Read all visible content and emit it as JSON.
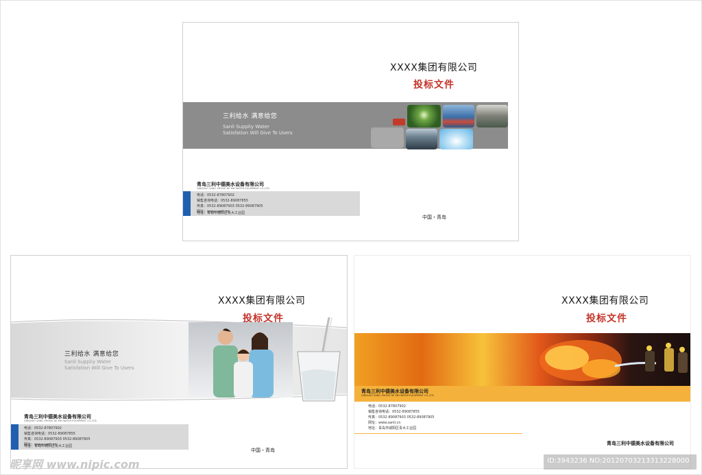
{
  "company_name": "XXXX集团有限公司",
  "doc_title": "投标文件",
  "slogan_cn": "三利给水 满意给您",
  "slogan_en_line1": "Sanli Suppliy Water",
  "slogan_en_line2": "Satisfation Will Give To Users",
  "supplier_cn": "青岛三利中德美水设备有限公司",
  "supplier_en": "QINGDAO SANLI ZHONG DE MEI WATER EQUIPMENT CO.,LTD.",
  "contact": {
    "phone": "电话：0532-87807902",
    "sales": "销售咨询电话：0532-89087855",
    "fax": "传真：0532-89087903 0532-89087905",
    "website": "网址：www.sanli.cn",
    "address": "地址：青岛市城阳区青大工业园"
  },
  "city": "中国・青岛",
  "watermark": {
    "site": "昵享网 www.nipic.com",
    "id": "ID:3943236 NO:20120703213313228000"
  },
  "colors": {
    "accent_red": "#c4332a",
    "grey_band": "#8c8c8c",
    "blue_strip": "#1f5fb0",
    "orange_band": "#f4b23c"
  }
}
